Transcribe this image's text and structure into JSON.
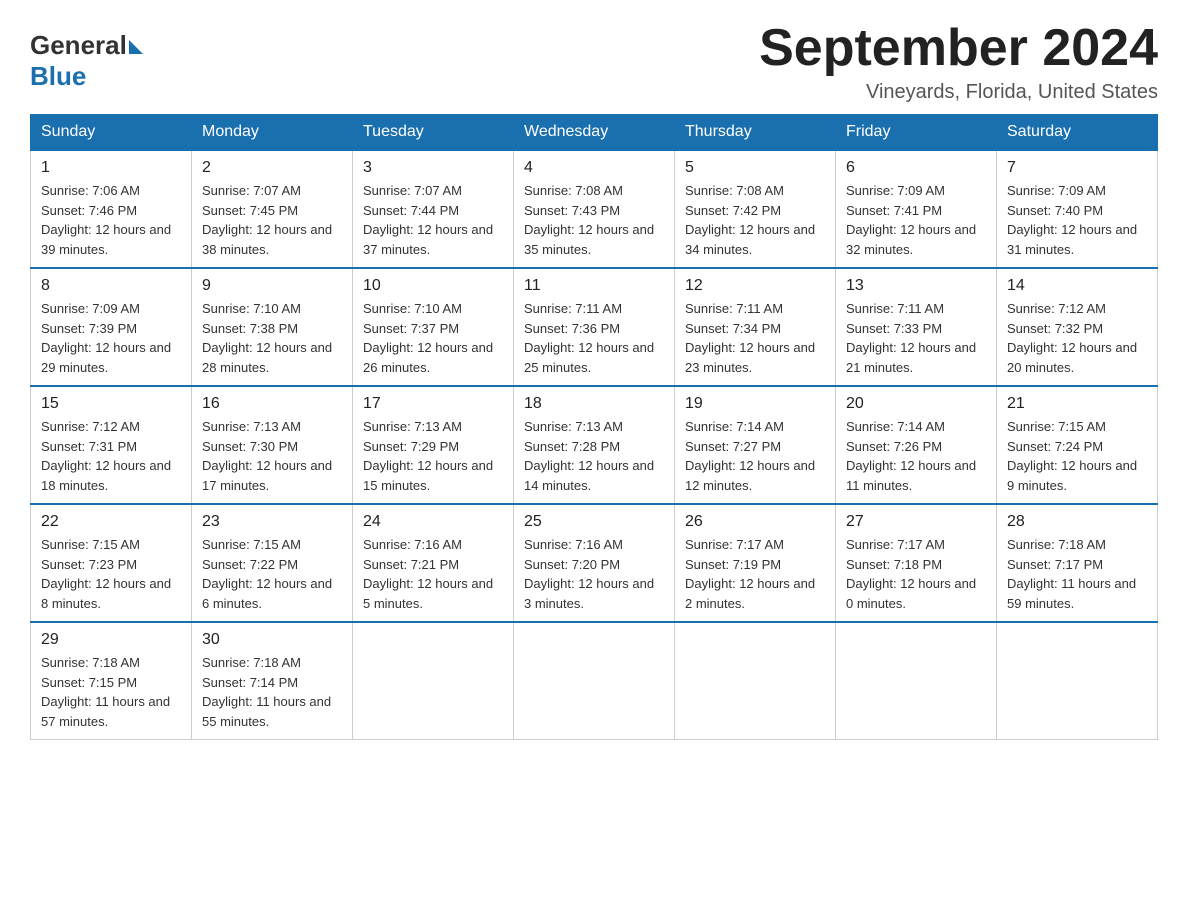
{
  "header": {
    "logo_general": "General",
    "logo_blue": "Blue",
    "title": "September 2024",
    "subtitle": "Vineyards, Florida, United States"
  },
  "days_of_week": [
    "Sunday",
    "Monday",
    "Tuesday",
    "Wednesday",
    "Thursday",
    "Friday",
    "Saturday"
  ],
  "weeks": [
    [
      {
        "day": "1",
        "sunrise": "7:06 AM",
        "sunset": "7:46 PM",
        "daylight": "12 hours and 39 minutes."
      },
      {
        "day": "2",
        "sunrise": "7:07 AM",
        "sunset": "7:45 PM",
        "daylight": "12 hours and 38 minutes."
      },
      {
        "day": "3",
        "sunrise": "7:07 AM",
        "sunset": "7:44 PM",
        "daylight": "12 hours and 37 minutes."
      },
      {
        "day": "4",
        "sunrise": "7:08 AM",
        "sunset": "7:43 PM",
        "daylight": "12 hours and 35 minutes."
      },
      {
        "day": "5",
        "sunrise": "7:08 AM",
        "sunset": "7:42 PM",
        "daylight": "12 hours and 34 minutes."
      },
      {
        "day": "6",
        "sunrise": "7:09 AM",
        "sunset": "7:41 PM",
        "daylight": "12 hours and 32 minutes."
      },
      {
        "day": "7",
        "sunrise": "7:09 AM",
        "sunset": "7:40 PM",
        "daylight": "12 hours and 31 minutes."
      }
    ],
    [
      {
        "day": "8",
        "sunrise": "7:09 AM",
        "sunset": "7:39 PM",
        "daylight": "12 hours and 29 minutes."
      },
      {
        "day": "9",
        "sunrise": "7:10 AM",
        "sunset": "7:38 PM",
        "daylight": "12 hours and 28 minutes."
      },
      {
        "day": "10",
        "sunrise": "7:10 AM",
        "sunset": "7:37 PM",
        "daylight": "12 hours and 26 minutes."
      },
      {
        "day": "11",
        "sunrise": "7:11 AM",
        "sunset": "7:36 PM",
        "daylight": "12 hours and 25 minutes."
      },
      {
        "day": "12",
        "sunrise": "7:11 AM",
        "sunset": "7:34 PM",
        "daylight": "12 hours and 23 minutes."
      },
      {
        "day": "13",
        "sunrise": "7:11 AM",
        "sunset": "7:33 PM",
        "daylight": "12 hours and 21 minutes."
      },
      {
        "day": "14",
        "sunrise": "7:12 AM",
        "sunset": "7:32 PM",
        "daylight": "12 hours and 20 minutes."
      }
    ],
    [
      {
        "day": "15",
        "sunrise": "7:12 AM",
        "sunset": "7:31 PM",
        "daylight": "12 hours and 18 minutes."
      },
      {
        "day": "16",
        "sunrise": "7:13 AM",
        "sunset": "7:30 PM",
        "daylight": "12 hours and 17 minutes."
      },
      {
        "day": "17",
        "sunrise": "7:13 AM",
        "sunset": "7:29 PM",
        "daylight": "12 hours and 15 minutes."
      },
      {
        "day": "18",
        "sunrise": "7:13 AM",
        "sunset": "7:28 PM",
        "daylight": "12 hours and 14 minutes."
      },
      {
        "day": "19",
        "sunrise": "7:14 AM",
        "sunset": "7:27 PM",
        "daylight": "12 hours and 12 minutes."
      },
      {
        "day": "20",
        "sunrise": "7:14 AM",
        "sunset": "7:26 PM",
        "daylight": "12 hours and 11 minutes."
      },
      {
        "day": "21",
        "sunrise": "7:15 AM",
        "sunset": "7:24 PM",
        "daylight": "12 hours and 9 minutes."
      }
    ],
    [
      {
        "day": "22",
        "sunrise": "7:15 AM",
        "sunset": "7:23 PM",
        "daylight": "12 hours and 8 minutes."
      },
      {
        "day": "23",
        "sunrise": "7:15 AM",
        "sunset": "7:22 PM",
        "daylight": "12 hours and 6 minutes."
      },
      {
        "day": "24",
        "sunrise": "7:16 AM",
        "sunset": "7:21 PM",
        "daylight": "12 hours and 5 minutes."
      },
      {
        "day": "25",
        "sunrise": "7:16 AM",
        "sunset": "7:20 PM",
        "daylight": "12 hours and 3 minutes."
      },
      {
        "day": "26",
        "sunrise": "7:17 AM",
        "sunset": "7:19 PM",
        "daylight": "12 hours and 2 minutes."
      },
      {
        "day": "27",
        "sunrise": "7:17 AM",
        "sunset": "7:18 PM",
        "daylight": "12 hours and 0 minutes."
      },
      {
        "day": "28",
        "sunrise": "7:18 AM",
        "sunset": "7:17 PM",
        "daylight": "11 hours and 59 minutes."
      }
    ],
    [
      {
        "day": "29",
        "sunrise": "7:18 AM",
        "sunset": "7:15 PM",
        "daylight": "11 hours and 57 minutes."
      },
      {
        "day": "30",
        "sunrise": "7:18 AM",
        "sunset": "7:14 PM",
        "daylight": "11 hours and 55 minutes."
      },
      null,
      null,
      null,
      null,
      null
    ]
  ],
  "labels": {
    "sunrise": "Sunrise:",
    "sunset": "Sunset:",
    "daylight": "Daylight:"
  }
}
